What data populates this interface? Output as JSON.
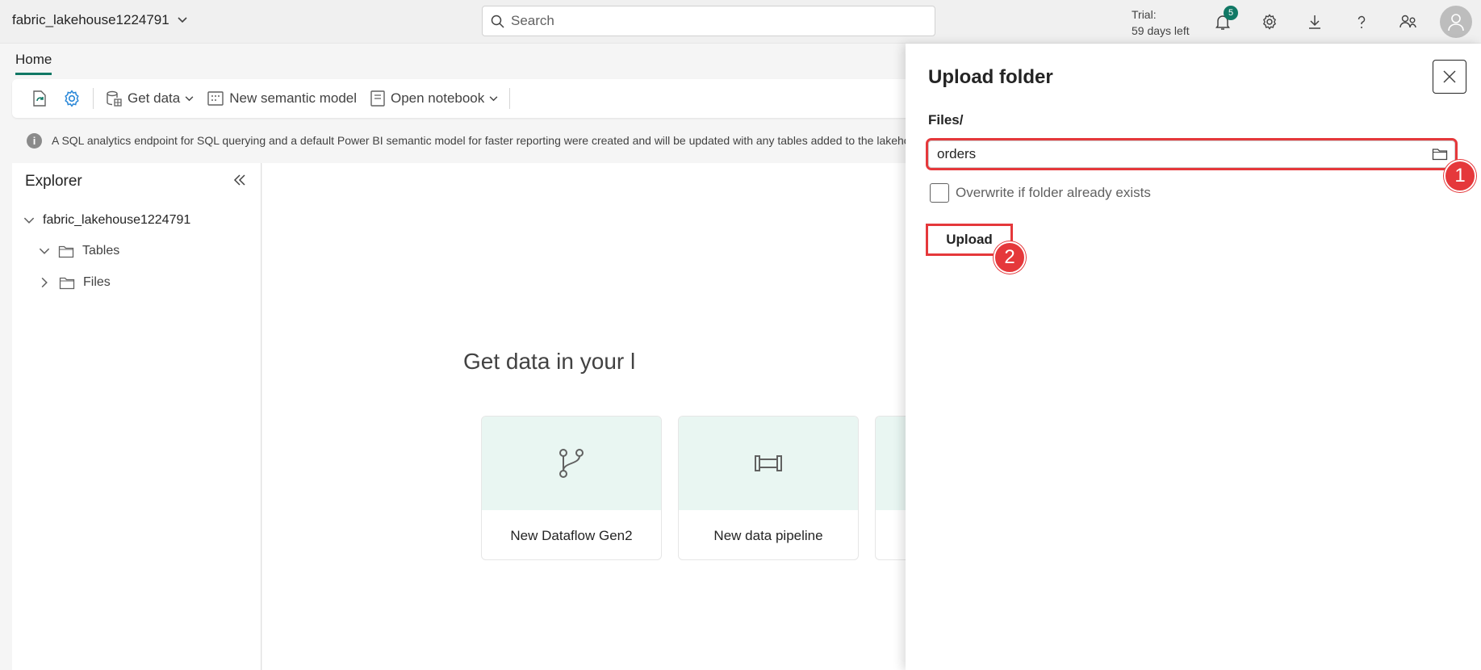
{
  "topbar": {
    "workspace_name": "fabric_lakehouse1224791",
    "search_placeholder": "Search",
    "trial_line1": "Trial:",
    "trial_line2": "59 days left",
    "notification_count": "5",
    "icons": [
      "bell-icon",
      "gear-icon",
      "download-icon",
      "help-icon",
      "share-icon",
      "user-avatar-icon"
    ]
  },
  "tabs": {
    "home": "Home"
  },
  "ribbon": {
    "get_data": "Get data",
    "new_semantic_model": "New semantic model",
    "open_notebook": "Open notebook"
  },
  "banner": {
    "text": "A SQL analytics endpoint for SQL querying and a default Power BI semantic model for faster reporting were created and will be updated with any tables added to the lakehouse"
  },
  "explorer": {
    "title": "Explorer",
    "root": "fabric_lakehouse1224791",
    "items": [
      {
        "label": "Tables",
        "expanded": true
      },
      {
        "label": "Files",
        "expanded": false
      }
    ]
  },
  "canvas": {
    "headline": "Get data in your l",
    "cards": [
      {
        "label": "New Dataflow Gen2",
        "icon": "dataflow-icon"
      },
      {
        "label": "New data pipeline",
        "icon": "pipeline-icon"
      }
    ]
  },
  "upload_panel": {
    "title": "Upload folder",
    "files_label": "Files/",
    "folder_value": "orders",
    "overwrite_label": "Overwrite if folder already exists",
    "upload_label": "Upload"
  },
  "annotations": {
    "step1": "1",
    "step2": "2",
    "color": "#e5383b"
  },
  "colors": {
    "accent": "#117865",
    "highlight": "#e5383b"
  }
}
